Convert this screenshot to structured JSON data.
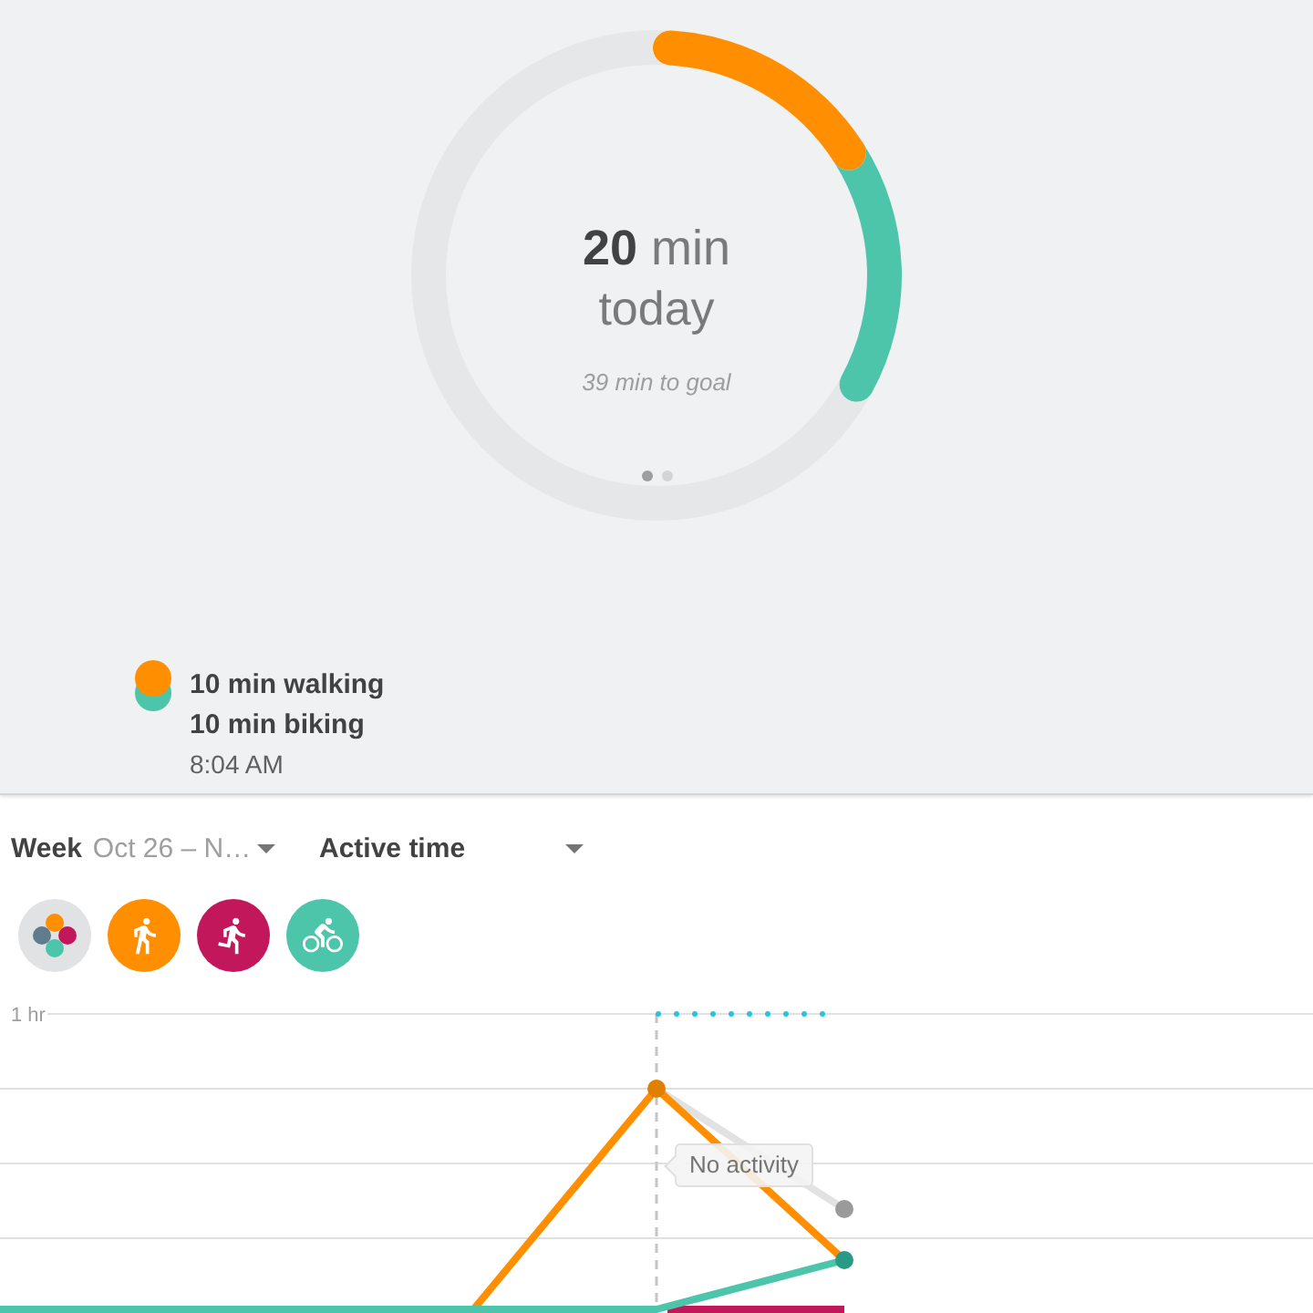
{
  "daily_goal": {
    "chart_data": {
      "type": "donut",
      "values": [
        16.95,
        16.95,
        66.1
      ]
    },
    "total": "**20** min",
    "period": "today",
    "goal_text": "39 min to goal",
    "pages": [
      {
        "selected": true
      },
      {
        "selected": false
      }
    ]
  },
  "activity_entry": {
    "dots": [
      {
        "color": "#ff8f00"
      },
      {
        "color": "#4dc5ab"
      }
    ],
    "lines": [
      "10 min walking",
      "10 min biking"
    ],
    "time": "8:04 AM"
  },
  "range_dropdown": {
    "label": "Week",
    "value": "Oct 26 – N…"
  },
  "metric_dropdown": {
    "label": "Active time"
  },
  "filters": [
    {
      "kind": "all"
    },
    {
      "kind": "walking",
      "color": "#ff8f00"
    },
    {
      "kind": "running",
      "color": "#c2185b"
    },
    {
      "kind": "biking",
      "color": "#4dc5ab"
    }
  ],
  "chart": {
    "tick_label": "1 hr",
    "tooltip": "No activity"
  }
}
